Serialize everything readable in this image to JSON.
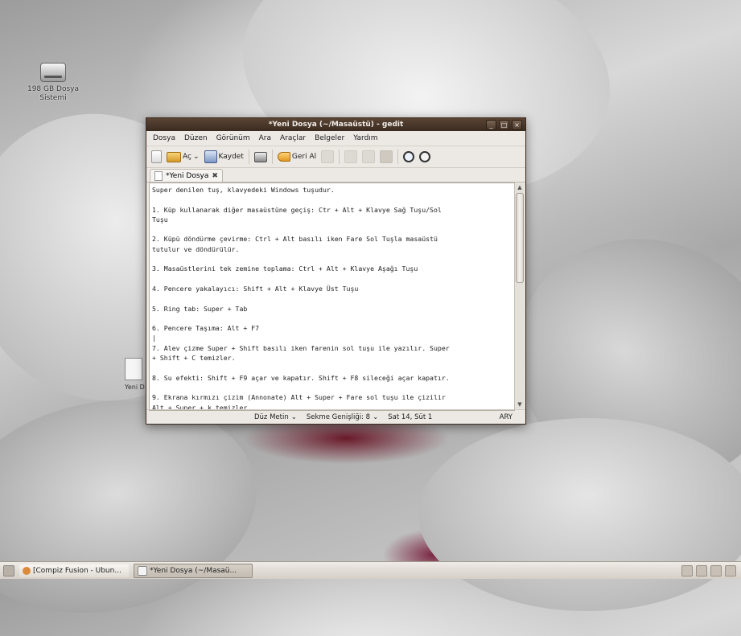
{
  "desktop": {
    "icons": [
      {
        "label": "198 GB Dosya\nSistemi"
      },
      {
        "label": "Yeni D"
      }
    ]
  },
  "window": {
    "title": "*Yeni Dosya (~/Masaüstü) - gedit",
    "buttons": [
      "_",
      "□",
      "×"
    ],
    "menu": [
      "Dosya",
      "Düzen",
      "Görünüm",
      "Ara",
      "Araçlar",
      "Belgeler",
      "Yardım"
    ],
    "toolbar": {
      "open_label": "Aç",
      "save_label": "Kaydet",
      "undo_label": "Geri Al"
    },
    "tab": {
      "label": "*Yeni Dosya",
      "close": "✖"
    },
    "content": "Super denilen tuş, klavyedeki Windows tuşudur.\n\n1. Küp kullanarak diğer masaüstüne geçiş: Ctr + Alt + Klavye Sağ Tuşu/Sol\nTuşu\n\n2. Küpü döndürme çevirme: Ctrl + Alt basılı iken Fare Sol Tuşla masaüstü\ntutulur ve döndürülür.\n\n3. Masaüstlerini tek zemine toplama: Ctrl + Alt + Klavye Aşağı Tuşu\n\n4. Pencere yakalayıcı: Shift + Alt + Klavye Üst Tuşu\n\n5. Ring tab: Super + Tab\n\n6. Pencere Taşıma: Alt + F7\n|\n7. Alev çizme Super + Shift basılı iken farenin sol tuşu ile yazılır. Super\n+ Shift + C temizler.\n\n8. Su efekti: Shift + F9 açar ve kapatır. Shift + F8 sileceği açar kapatır.\n\n9. Ekrana kırmızı çizim (Annonate) Alt + Super + Fare sol tuşu ile çizilir\nAlt + Super + k temizler",
    "status": {
      "mode": "Düz Metin",
      "tab_width": "Sekme Genişliği: 8",
      "position": "Sat 14, Süt 1",
      "insert_mode": "ARY"
    }
  },
  "taskbar": {
    "tasks": [
      {
        "label": "[Compiz Fusion - Ubun..."
      },
      {
        "label": "*Yeni Dosya (~/Masaü..."
      }
    ]
  }
}
